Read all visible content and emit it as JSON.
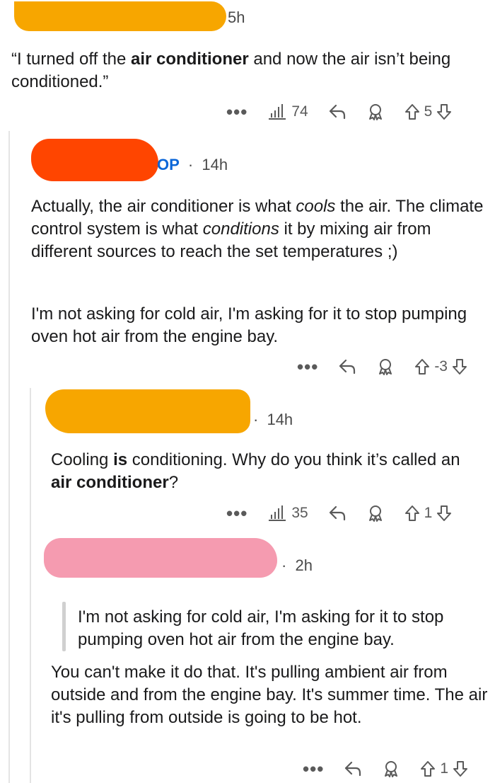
{
  "comments": [
    {
      "time": "5h",
      "text_parts": [
        {
          "t": "“I turned off the ",
          "b": false
        },
        {
          "t": "air conditioner",
          "b": true
        },
        {
          "t": " and now the air isn’t being conditioned.”",
          "b": false
        }
      ],
      "views": "74",
      "score": "5",
      "blob_color": "#f7a600"
    },
    {
      "flair": "OP",
      "time": "14h",
      "para1_parts": [
        {
          "t": "Actually, the air conditioner is what ",
          "i": false
        },
        {
          "t": "cools",
          "i": true
        },
        {
          "t": " the air. The climate control system is what ",
          "i": false
        },
        {
          "t": "conditions",
          "i": true
        },
        {
          "t": " it by mixing air from different sources to reach the set temperatures ;)",
          "i": false
        }
      ],
      "para2": "I'm not asking for cold air, I'm asking for it to stop pumping oven hot air from the engine bay.",
      "score": "-3",
      "blob_color": "#ff4500"
    },
    {
      "time": "14h",
      "text_parts": [
        {
          "t": "Cooling ",
          "b": false
        },
        {
          "t": "is",
          "b": true
        },
        {
          "t": " conditioning. Why do you think it’s called an ",
          "b": false
        },
        {
          "t": "air conditioner",
          "b": true
        },
        {
          "t": "?",
          "b": false
        }
      ],
      "views": "35",
      "score": "1",
      "blob_color": "#f7a600"
    },
    {
      "time": "2h",
      "quote": "I'm not asking for cold air, I'm asking for it to stop pumping oven hot air from the engine bay.",
      "text": "You can't make it do that. It's pulling ambient air from outside and from the engine bay. It's summer time. The air it's pulling from outside is going to be hot.",
      "score": "1",
      "blob_color": "#f59bb0"
    }
  ],
  "separator": "·",
  "icons": {
    "more": "more-dots-icon",
    "views": "bar-chart-icon",
    "reply": "reply-arrow-icon",
    "award": "award-icon",
    "upvote": "upvote-arrow-icon",
    "downvote": "downvote-arrow-icon"
  }
}
